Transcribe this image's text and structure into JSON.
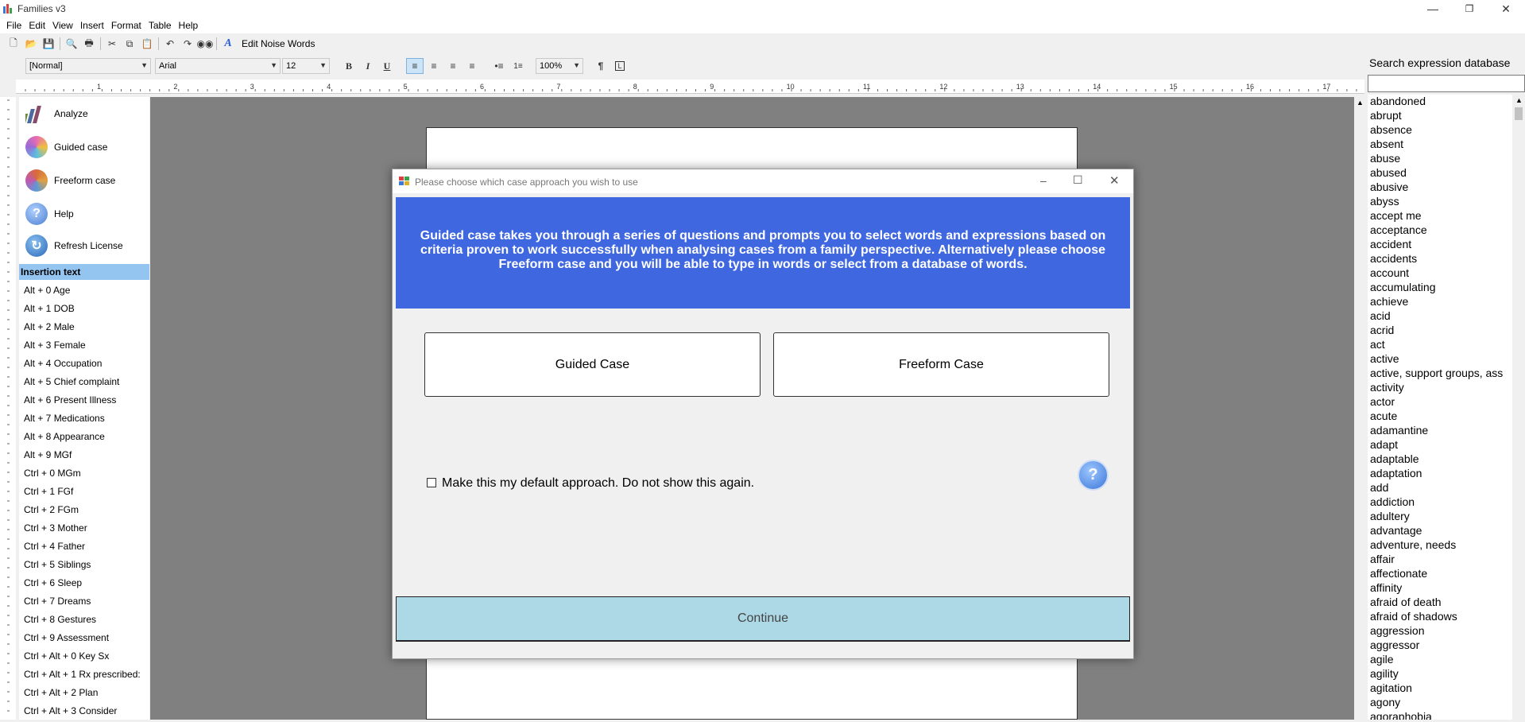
{
  "app": {
    "title": "Families v3"
  },
  "menu": [
    "File",
    "Edit",
    "View",
    "Insert",
    "Format",
    "Table",
    "Help"
  ],
  "toolbar": {
    "edit_noise_words": "Edit Noise Words"
  },
  "format_bar": {
    "style": "[Normal]",
    "font": "Arial",
    "size": "12",
    "zoom": "100%",
    "bold": "B",
    "italic": "I",
    "underline": "U"
  },
  "ruler_numbers": [
    "1",
    "2",
    "3",
    "4",
    "5",
    "6",
    "7",
    "8",
    "9",
    "10",
    "11",
    "12",
    "13",
    "14",
    "15",
    "16",
    "17"
  ],
  "sidebar": {
    "buttons": [
      {
        "label": "Analyze",
        "color": "#4a7a3a"
      },
      {
        "label": "Guided case",
        "color": "#e86bb0"
      },
      {
        "label": "Freeform case",
        "color": "#d96a3a"
      },
      {
        "label": "Help",
        "color": "#5a8fd8"
      },
      {
        "label": "Refresh License",
        "color": "#3a78c8"
      }
    ],
    "insertion_header": "Insertion text",
    "insertion_items": [
      "Alt + 0 Age",
      "Alt + 1 DOB",
      "Alt + 2 Male",
      "Alt + 3 Female",
      "Alt + 4 Occupation",
      "Alt + 5 Chief complaint",
      "Alt + 6 Present Illness",
      "Alt + 7 Medications",
      "Alt + 8 Appearance",
      "Alt + 9 MGf",
      "Ctrl + 0 MGm",
      "Ctrl + 1 FGf",
      "Ctrl + 2 FGm",
      "Ctrl + 3 Mother",
      "Ctrl + 4 Father",
      "Ctrl + 5 Siblings",
      "Ctrl + 6 Sleep",
      "Ctrl + 7 Dreams",
      "Ctrl + 8 Gestures",
      "Ctrl + 9 Assessment",
      "Ctrl + Alt + 0 Key Sx",
      "Ctrl + Alt + 1 Rx prescribed:",
      "Ctrl + Alt + 2 Plan",
      "Ctrl + Alt + 3 Consider"
    ]
  },
  "search_panel": {
    "title": "Search expression database",
    "search_value": "",
    "results": [
      "abandoned",
      "abrupt",
      "absence",
      "absent",
      "abuse",
      "abused",
      "abusive",
      "abyss",
      "accept me",
      "acceptance",
      "accident",
      "accidents",
      "account",
      "accumulating",
      "achieve",
      "acid",
      "acrid",
      "act",
      "active",
      "active, support groups, ass",
      "activity",
      "actor",
      "acute",
      "adamantine",
      "adapt",
      "adaptable",
      "adaptation",
      "add",
      "addiction",
      "adultery",
      "advantage",
      "adventure, needs",
      "affair",
      "affectionate",
      "affinity",
      "afraid of death",
      "afraid of shadows",
      "aggression",
      "aggressor",
      "agile",
      "agility",
      "agitation",
      "agony",
      "agoraphobia"
    ]
  },
  "dialog": {
    "title": "Please choose which case approach you wish to use",
    "banner_text": "Guided case takes you through a series of questions and prompts you to select words and expressions based on criteria proven to work successfully when analysing cases from a family perspective.  Alternatively please choose Freeform case and you will be able to type in words or select from a database of words.",
    "guided_label": "Guided Case",
    "freeform_label": "Freeform Case",
    "checkbox_label": "Make this my default approach.  Do not show this again.",
    "checkbox_checked": false,
    "help_glyph": "?",
    "continue_label": "Continue",
    "banner_color": "#3f67e0",
    "continue_color": "#add8e6"
  }
}
